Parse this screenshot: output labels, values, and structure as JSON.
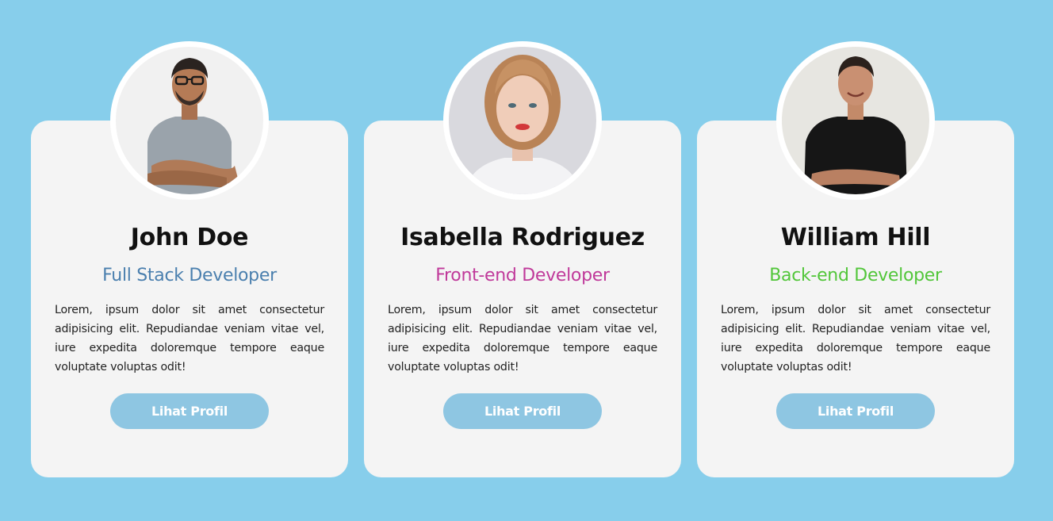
{
  "cards": [
    {
      "name": "John Doe",
      "role": "Full Stack Developer",
      "role_color": "#4a7fae",
      "description": "Lorem, ipsum dolor sit amet consectetur adipisicing elit. Repudiandae veniam vitae vel, iure expedita doloremque tempore eaque voluptate voluptas odit!",
      "button_label": "Lihat Profil",
      "photo": "man-with-glasses-gray-shirt-arms-crossed"
    },
    {
      "name": "Isabella Rodriguez",
      "role": "Front-end Developer",
      "role_color": "#c0399a",
      "description": "Lorem, ipsum dolor sit amet consectetur adipisicing elit. Repudiandae veniam vitae vel, iure expedita doloremque tempore eaque voluptate voluptas odit!",
      "button_label": "Lihat Profil",
      "photo": "woman-blonde-hair-white-top"
    },
    {
      "name": "William Hill",
      "role": "Back-end Developer",
      "role_color": "#52c63a",
      "description": "Lorem, ipsum dolor sit amet consectetur adipisicing elit. Repudiandae veniam vitae vel, iure expedita doloremque tempore eaque voluptate voluptas odit!",
      "button_label": "Lihat Profil",
      "photo": "man-black-tshirt-arms-crossed"
    }
  ],
  "colors": {
    "background": "#87ceeb",
    "card": "#f4f4f4",
    "button": "#8ec6e2"
  }
}
